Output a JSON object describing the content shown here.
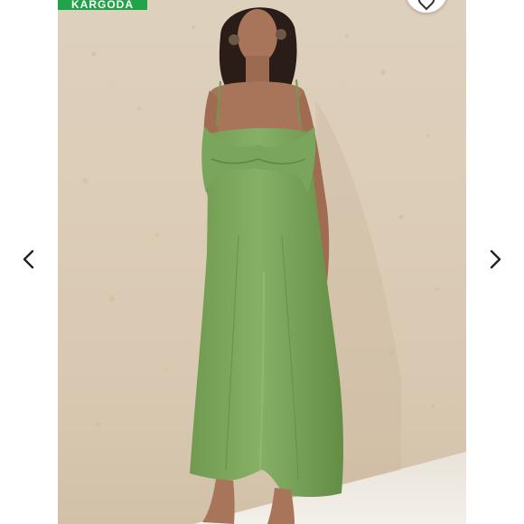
{
  "badge": {
    "text": "KARGODA",
    "color": "#21a34a"
  },
  "navigation": {
    "prev_icon": "chevron-left-icon",
    "next_icon": "chevron-right-icon"
  },
  "favorite": {
    "icon": "heart-icon"
  },
  "photo": {
    "subject": "dress-photo"
  },
  "colors": {
    "dress": "#7aa55c",
    "wall": "#dccdb7",
    "background": "#ffffff"
  }
}
